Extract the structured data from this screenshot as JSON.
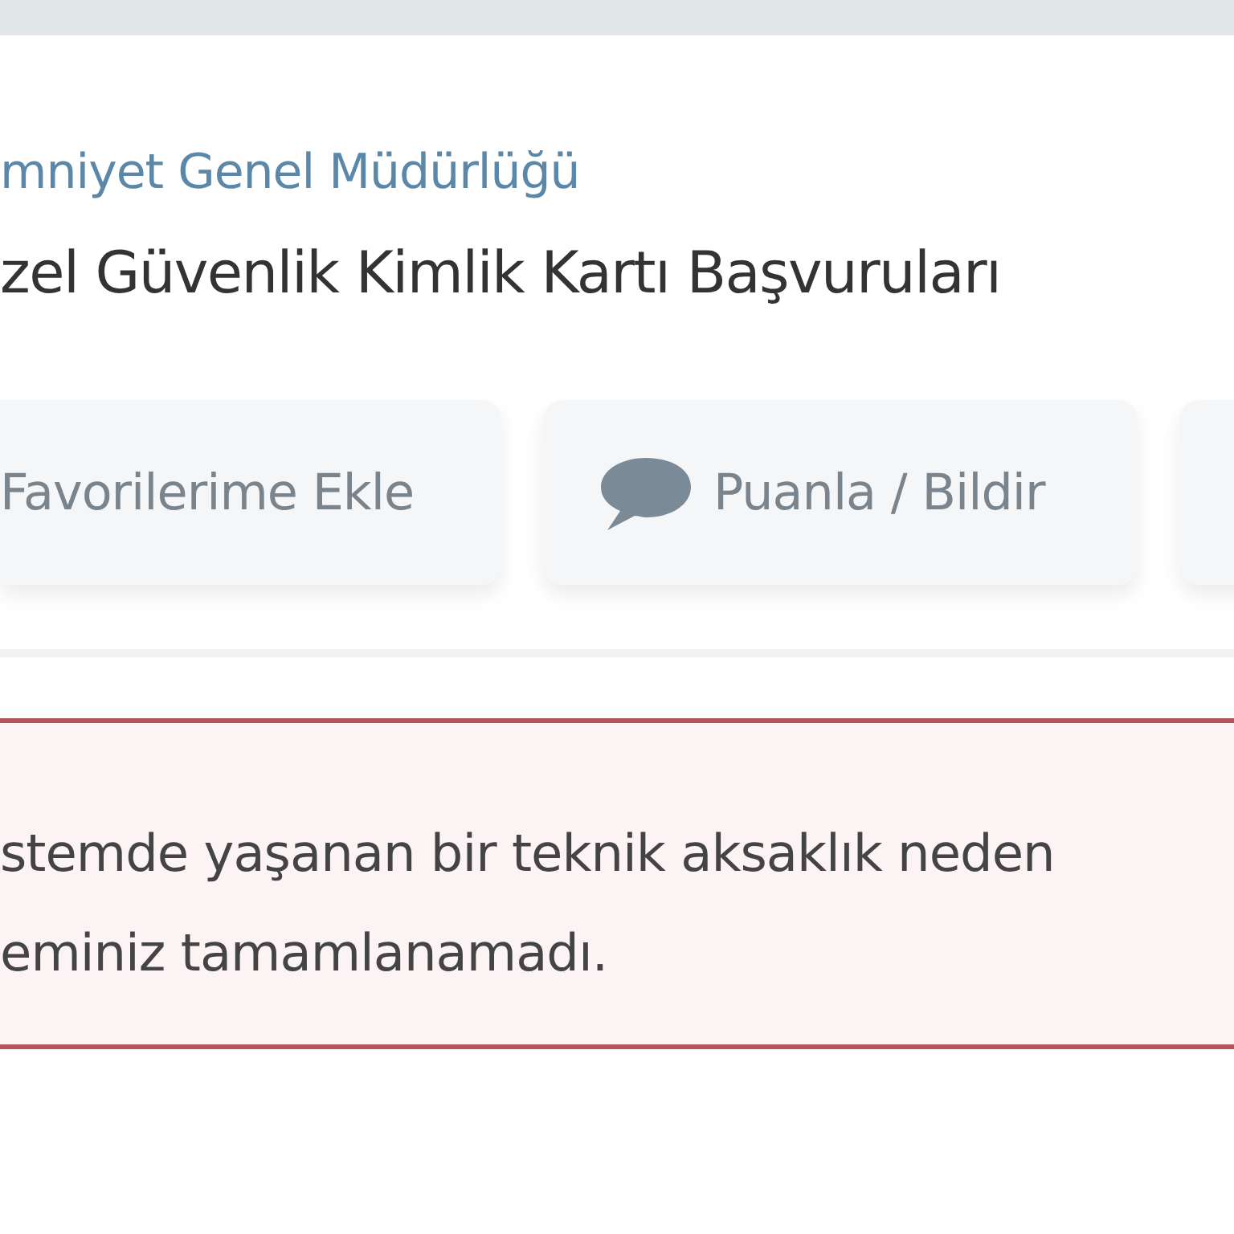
{
  "header": {
    "agency": "mniyet Genel Müdürlüğü",
    "service_title": "zel Güvenlik Kimlik Kartı Başvuruları"
  },
  "actions": [
    {
      "kind": "plain",
      "label": "Favorilerime Ekle"
    },
    {
      "kind": "comment",
      "label": "Puanla / Bildir"
    },
    {
      "kind": "cut"
    }
  ],
  "alert": {
    "lines": [
      "stemde yaşanan bir teknik aksaklık neden",
      "eminiz tamamlanamadı."
    ]
  }
}
